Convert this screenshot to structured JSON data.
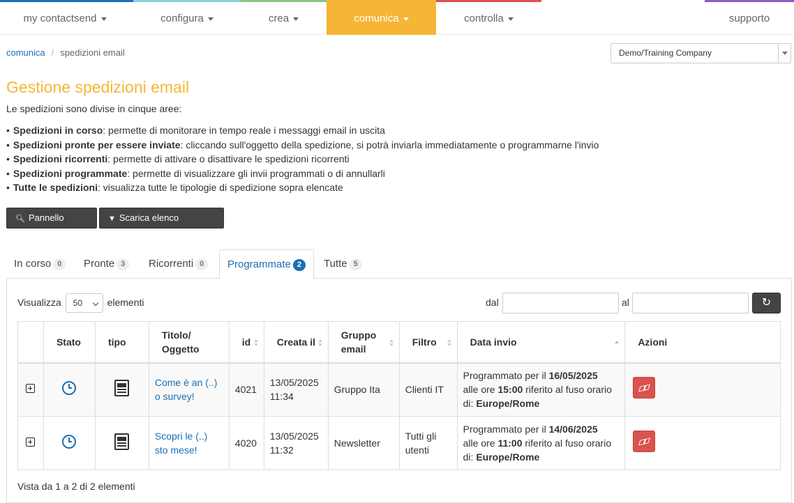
{
  "colors": {
    "accent": "#f7b535",
    "link": "#1a6fb5",
    "danger": "#d9534f",
    "dark_button": "#444444",
    "nav_strips": [
      "#1a6fb5",
      "#8ad1dc",
      "#8cc484",
      "#f7b535",
      "#e05252",
      "#8e5bc7"
    ]
  },
  "nav": {
    "items": [
      {
        "label": "my contactsend",
        "icon": "chevron-down-icon"
      },
      {
        "label": "configura",
        "icon": "chevron-down-icon"
      },
      {
        "label": "crea",
        "icon": "chevron-down-icon"
      },
      {
        "label": "comunica",
        "icon": "chevron-down-icon",
        "active": true
      },
      {
        "label": "controlla",
        "icon": "chevron-down-icon"
      }
    ],
    "support_label": "supporto"
  },
  "breadcrumb": {
    "parent": "comunica",
    "current": "spedizioni email",
    "separator": "/"
  },
  "company_select": {
    "value": "Demo/Training Company"
  },
  "page": {
    "title": "Gestione spedizioni email",
    "intro": "Le spedizioni sono divise in cinque aree:",
    "areas": [
      {
        "name": "Spedizioni in corso",
        "desc": ": permette di monitorare in tempo reale i messaggi email in uscita"
      },
      {
        "name": "Spedizioni pronte per essere inviate",
        "desc": ": cliccando sull'oggetto della spedizione, si potrà inviarla immediatamente o programmarne l'invio"
      },
      {
        "name": "Spedizioni ricorrenti",
        "desc": ": permette di attivare o disattivare le spedizioni ricorrenti"
      },
      {
        "name": "Spedizioni programmate",
        "desc": ": permette di visualizzare gli invii programmati o di annullarli"
      },
      {
        "name": "Tutte le spedizioni",
        "desc": ": visualizza tutte le tipologie di spedizione sopra elencate"
      }
    ]
  },
  "buttons": {
    "search_panel": "Pannello ricerca",
    "download_list": "Scarica elenco spedizioni"
  },
  "tabs": [
    {
      "label": "In corso",
      "count": "0"
    },
    {
      "label": "Pronte",
      "count": "3"
    },
    {
      "label": "Ricorrenti",
      "count": "0"
    },
    {
      "label": "Programmate",
      "count": "2",
      "active": true
    },
    {
      "label": "Tutte",
      "count": "5"
    }
  ],
  "table_controls": {
    "show_label": "Visualizza",
    "page_size": "50",
    "elements_label": "elementi",
    "from_label": "dal",
    "to_label": "al",
    "from_value": "",
    "to_value": ""
  },
  "table": {
    "headers": [
      "",
      "Stato",
      "tipo",
      "Titolo/ Oggetto",
      "id",
      "Creata il",
      "Gruppo email",
      "Filtro",
      "Data invio",
      "Azioni"
    ],
    "rows": [
      {
        "status_icon": "clock-icon",
        "type_icon": "newsletter-doc-icon",
        "title": "Come è an (..) o survey!",
        "id": "4021",
        "created": "13/05/2025 11:34",
        "group": "Gruppo Ita",
        "filter": "Clienti IT",
        "send_prefix": "Programmato per il",
        "send_date": "16/05/2025",
        "send_mid1": "alle ore",
        "send_time": "15:00",
        "send_mid2": "riferito al fuso orario di:",
        "send_tz": "Europe/Rome",
        "action_icon": "eraser-icon"
      },
      {
        "status_icon": "clock-icon",
        "type_icon": "newsletter-doc-icon",
        "title": "Scopri le (..) sto mese!",
        "id": "4020",
        "created": "13/05/2025 11:32",
        "group": "Newsletter",
        "filter": "Tutti gli utenti",
        "send_prefix": "Programmato per il",
        "send_date": "14/06/2025",
        "send_mid1": "alle ore",
        "send_time": "11:00",
        "send_mid2": "riferito al fuso orario di:",
        "send_tz": "Europe/Rome",
        "action_icon": "eraser-icon"
      }
    ]
  },
  "footer": {
    "info": "Vista da 1 a 2 di 2 elementi"
  }
}
